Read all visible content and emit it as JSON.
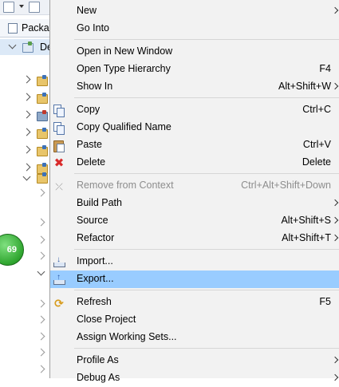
{
  "explorer": {
    "tab_label": "Packa",
    "selected_row_label": "De",
    "badge_text": "69"
  },
  "menu": {
    "items": [
      {
        "label": "New",
        "accel": "",
        "submenu": true
      },
      {
        "label": "Go Into",
        "accel": ""
      },
      {
        "label": "Open in New Window",
        "accel": ""
      },
      {
        "label": "Open Type Hierarchy",
        "accel": "F4"
      },
      {
        "label": "Show In",
        "accel": "Alt+Shift+W",
        "submenu": true
      },
      {
        "label": "Copy",
        "accel": "Ctrl+C",
        "icon": "copy-icon"
      },
      {
        "label": "Copy Qualified Name",
        "accel": "",
        "icon": "copy-qualified-name-icon"
      },
      {
        "label": "Paste",
        "accel": "Ctrl+V",
        "icon": "paste-icon"
      },
      {
        "label": "Delete",
        "accel": "Delete",
        "icon": "delete-icon"
      },
      {
        "label": "Remove from Context",
        "accel": "Ctrl+Alt+Shift+Down",
        "icon": "remove-from-context-icon",
        "disabled": true
      },
      {
        "label": "Build Path",
        "accel": "",
        "submenu": true
      },
      {
        "label": "Source",
        "accel": "Alt+Shift+S",
        "submenu": true
      },
      {
        "label": "Refactor",
        "accel": "Alt+Shift+T",
        "submenu": true
      },
      {
        "label": "Import...",
        "accel": "",
        "icon": "import-icon"
      },
      {
        "label": "Export...",
        "accel": "",
        "icon": "export-icon",
        "highlighted": true
      },
      {
        "label": "Refresh",
        "accel": "F5",
        "icon": "refresh-icon"
      },
      {
        "label": "Close Project",
        "accel": ""
      },
      {
        "label": "Assign Working Sets...",
        "accel": ""
      },
      {
        "label": "Profile As",
        "accel": "",
        "submenu": true
      },
      {
        "label": "Debug As",
        "accel": "",
        "submenu": true
      }
    ]
  },
  "colors": {
    "menu_background": "#f2f2f2",
    "highlight": "#99ccff",
    "separator": "#d6d6d6",
    "disabled_text": "#8d8d8d"
  }
}
